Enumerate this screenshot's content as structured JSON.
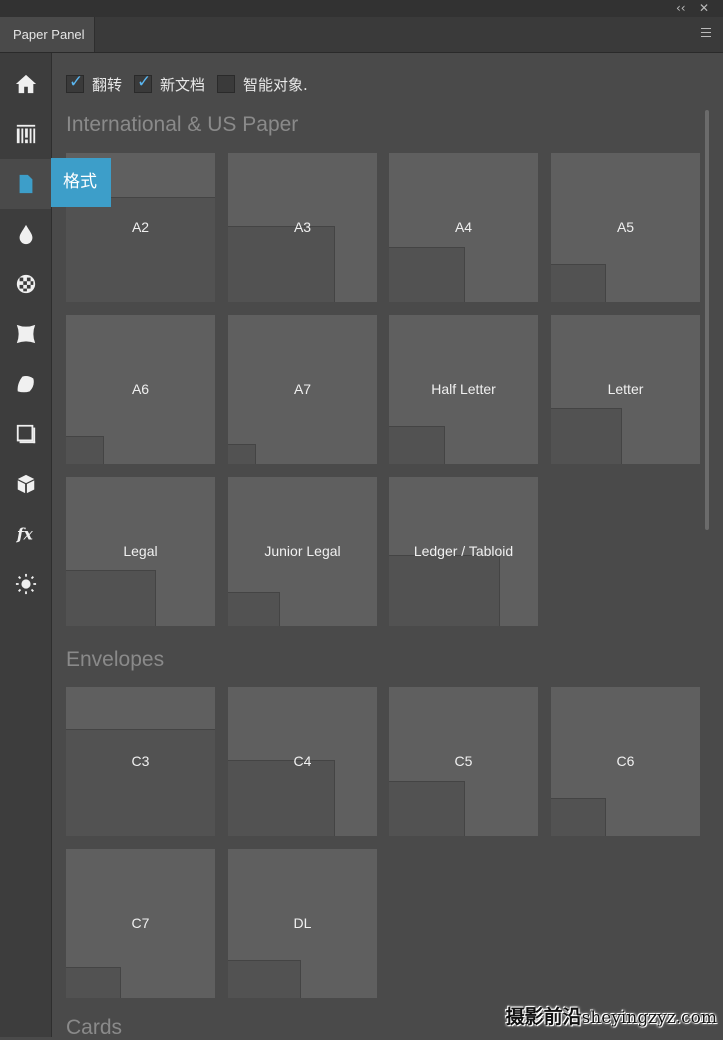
{
  "panel": {
    "title": "Paper Panel"
  },
  "window_controls": {
    "collapse": "‹‹",
    "close": "✕"
  },
  "sidebar": {
    "items": [
      {
        "icon": "home-icon"
      },
      {
        "icon": "texture-icon"
      },
      {
        "icon": "document-icon",
        "active": true
      },
      {
        "icon": "drop-icon"
      },
      {
        "icon": "checker-icon"
      },
      {
        "icon": "warp-icon"
      },
      {
        "icon": "scroll-icon"
      },
      {
        "icon": "frame-icon"
      },
      {
        "icon": "cube-icon"
      },
      {
        "icon": "fx-icon"
      },
      {
        "icon": "sun-icon"
      }
    ],
    "tooltip": "格式"
  },
  "options": [
    {
      "label": "翻转",
      "checked": true
    },
    {
      "label": "新文档",
      "checked": true
    },
    {
      "label": "智能对象.",
      "checked": false
    }
  ],
  "sections": [
    {
      "title": "International & US Paper",
      "items": [
        {
          "label": "A2",
          "frac": [
            1.0,
            0.7
          ]
        },
        {
          "label": "A3",
          "frac": [
            0.71,
            0.5
          ]
        },
        {
          "label": "A4",
          "frac": [
            0.5,
            0.36
          ]
        },
        {
          "label": "A5",
          "frac": [
            0.36,
            0.25
          ]
        },
        {
          "label": "A6",
          "frac": [
            0.25,
            0.18
          ]
        },
        {
          "label": "A7",
          "frac": [
            0.18,
            0.13
          ]
        },
        {
          "label": "Half Letter",
          "frac": [
            0.37,
            0.25
          ]
        },
        {
          "label": "Letter",
          "frac": [
            0.47,
            0.37
          ]
        },
        {
          "label": "Legal",
          "frac": [
            0.6,
            0.37
          ]
        },
        {
          "label": "Junior Legal",
          "frac": [
            0.34,
            0.22
          ]
        },
        {
          "label": "Ledger / Tabloid",
          "frac": [
            0.74,
            0.47
          ]
        }
      ]
    },
    {
      "title": "Envelopes",
      "items": [
        {
          "label": "C3",
          "frac": [
            1.0,
            0.71
          ]
        },
        {
          "label": "C4",
          "frac": [
            0.71,
            0.5
          ]
        },
        {
          "label": "C5",
          "frac": [
            0.5,
            0.36
          ]
        },
        {
          "label": "C6",
          "frac": [
            0.36,
            0.25
          ]
        },
        {
          "label": "C7",
          "frac": [
            0.36,
            0.2
          ]
        },
        {
          "label": "DL",
          "frac": [
            0.48,
            0.25
          ]
        }
      ]
    },
    {
      "title": "Cards",
      "items": []
    }
  ],
  "watermark": {
    "cn": "摄影前沿",
    "en": "sheyingzyz.com"
  }
}
